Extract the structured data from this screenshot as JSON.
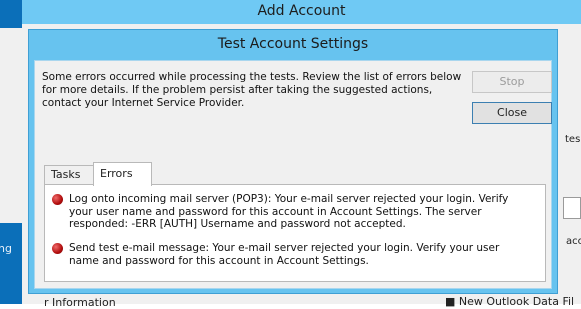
{
  "background_window": {
    "title": "Add Account",
    "left_fragment": "ng",
    "right_fragments": [
      "tes",
      "acc"
    ],
    "bottom_left_fragment": "r Information",
    "bottom_right_fragment": "■ New Outlook Data Fil"
  },
  "dialog": {
    "title": "Test Account Settings",
    "message": "Some errors occurred while processing the tests. Review the list of errors below for more details. If the problem persist after taking the suggested actions, contact your Internet Service Provider.",
    "buttons": {
      "stop": "Stop",
      "close": "Close"
    },
    "tabs": [
      {
        "label": "Tasks",
        "selected": false
      },
      {
        "label": "Errors",
        "selected": true
      }
    ],
    "errors": [
      {
        "icon": "error-icon",
        "text": "Log onto incoming mail server (POP3): Your e-mail server rejected your login. Verify your user name and password for this account in Account Settings.  The server responded: -ERR [AUTH] Username and password not accepted."
      },
      {
        "icon": "error-icon",
        "text": "Send test e-mail message: Your e-mail server rejected your login. Verify your user name and password for this account in Account Settings."
      }
    ]
  }
}
